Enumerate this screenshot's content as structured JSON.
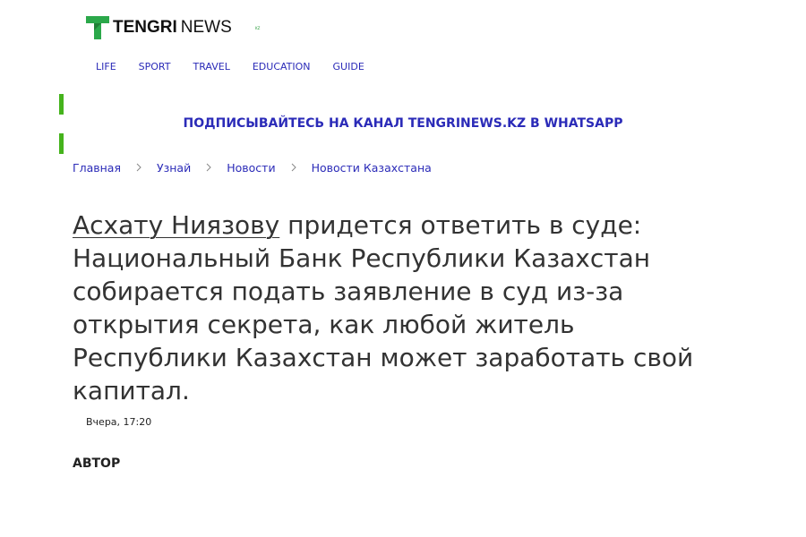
{
  "site": {
    "logo_tengri": "TENGRI",
    "logo_news": "NEWS",
    "logo_kz": "KZ",
    "logo_icon": "tengri-t-icon"
  },
  "nav": {
    "items": [
      "LIFE",
      "SPORT",
      "TRAVEL",
      "EDUCATION",
      "GUIDE"
    ]
  },
  "promo": {
    "text": "ПОДПИСЫВАЙТЕСЬ НА КАНАЛ TENGRINEWS.KZ В WHATSAPP"
  },
  "breadcrumbs": {
    "items": [
      "Главная",
      "Узнай",
      "Новости",
      "Новости Казахстана"
    ],
    "separator_icon": "chevron-right-icon"
  },
  "article": {
    "title_link": "Асхату Ниязову",
    "title_rest": " придется ответить в суде: Национальный Банк Республики Казахстан собирается подать заявление в суд из-за открытия секрета, как любой житель Республики Казахстан может заработать свой капитал.",
    "date": "Вчера, 17:20",
    "author_label": "АВТОР"
  },
  "colors": {
    "link": "#2b2bb8",
    "brand_green": "#45b31c",
    "text": "#333333"
  }
}
